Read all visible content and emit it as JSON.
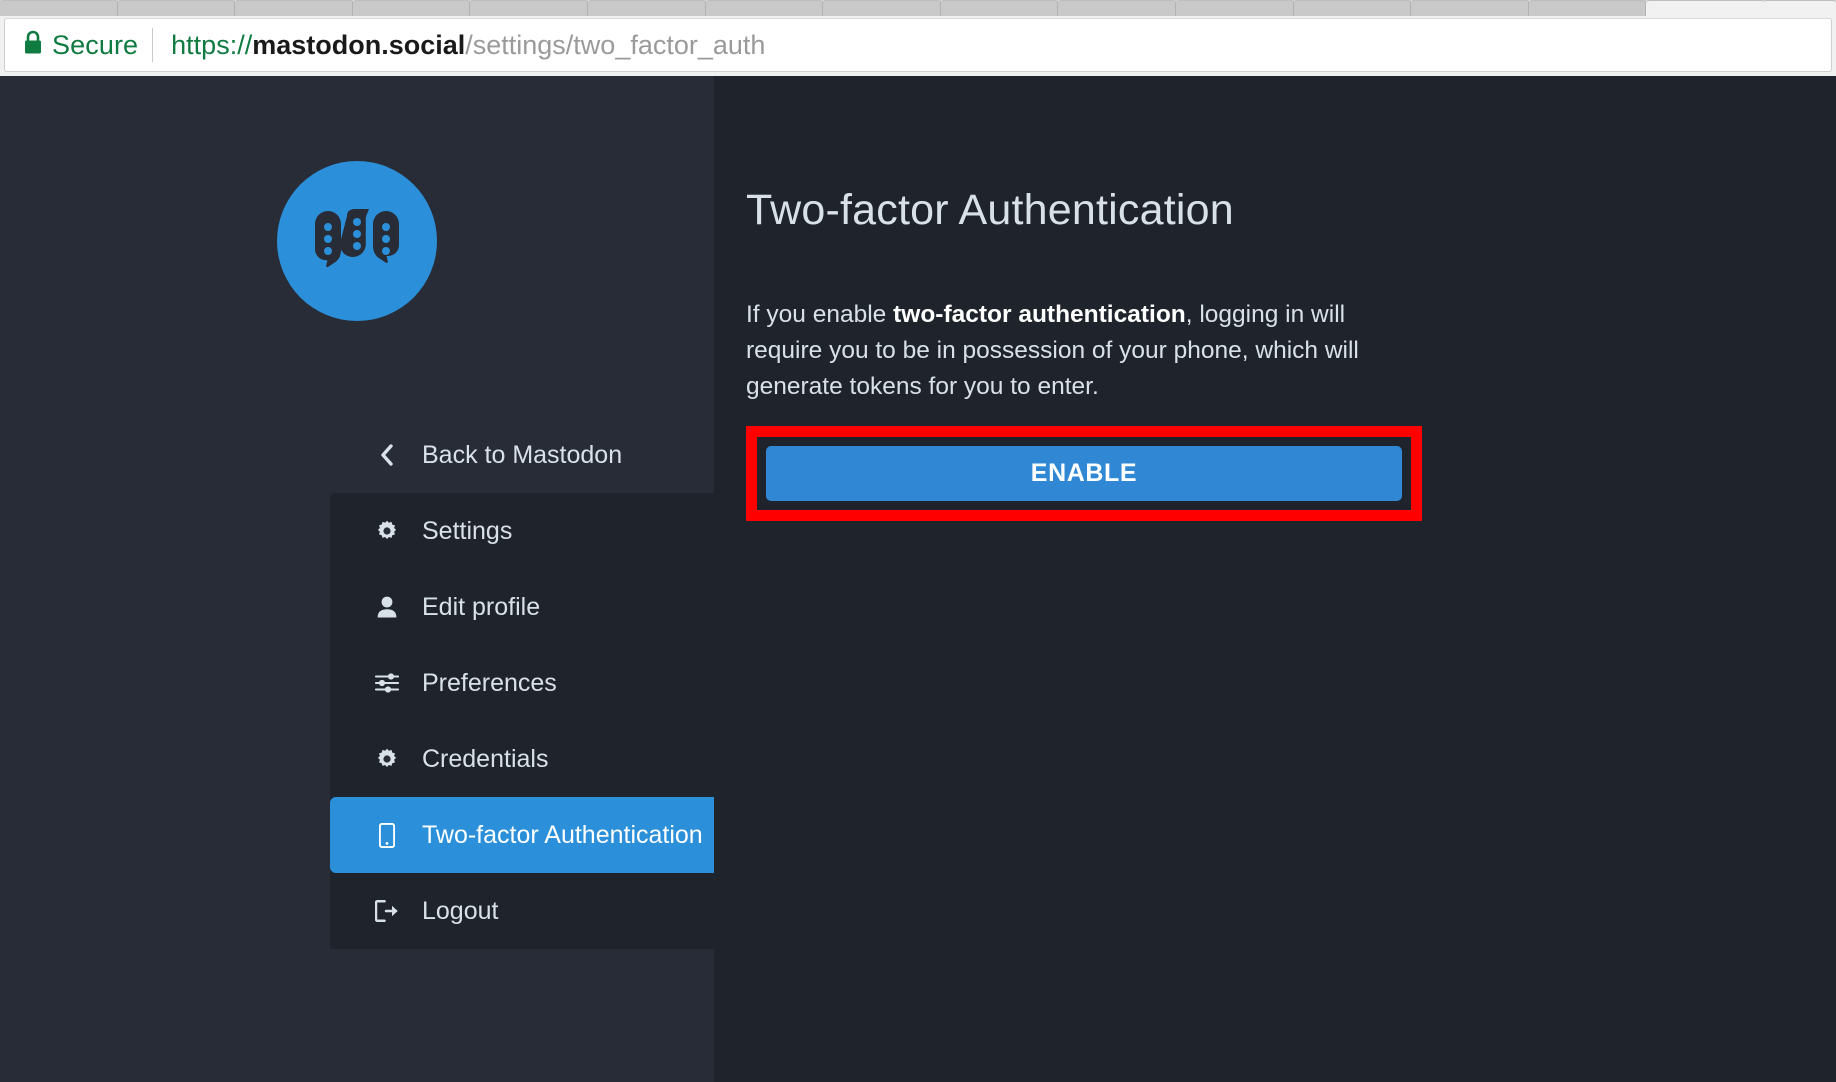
{
  "browser": {
    "security_label": "Secure",
    "lock_icon": "lock-icon",
    "url": {
      "scheme": "https://",
      "host": "mastodon.social",
      "path": "/settings/two_factor_auth"
    },
    "tab_count": 16
  },
  "sidebar": {
    "logo_icon": "mastodon-logo-icon",
    "back": {
      "label": "Back to Mastodon",
      "icon": "chevron-left-icon"
    },
    "items": [
      {
        "label": "Settings",
        "icon": "gear-icon",
        "active": false
      },
      {
        "label": "Edit profile",
        "icon": "user-icon",
        "active": false
      },
      {
        "label": "Preferences",
        "icon": "sliders-icon",
        "active": false
      },
      {
        "label": "Credentials",
        "icon": "gear-icon",
        "active": false
      },
      {
        "label": "Two-factor Authentication",
        "icon": "mobile-icon",
        "active": true
      },
      {
        "label": "Logout",
        "icon": "sign-out-icon",
        "active": false
      }
    ]
  },
  "main": {
    "title": "Two-factor Authentication",
    "description_prefix": "If you enable ",
    "description_bold": "two-factor authentication",
    "description_suffix": ", logging in will require you to be in possession of your phone, which will generate tokens for you to enter.",
    "enable_label": "ENABLE"
  },
  "colors": {
    "accent_blue": "#2b90d9",
    "button_blue": "#3088d4",
    "sidebar_bg": "#282c37",
    "content_bg": "#1f232b",
    "text": "#d9e1e8",
    "highlight_red": "#ff0000",
    "secure_green": "#0f7b41"
  }
}
